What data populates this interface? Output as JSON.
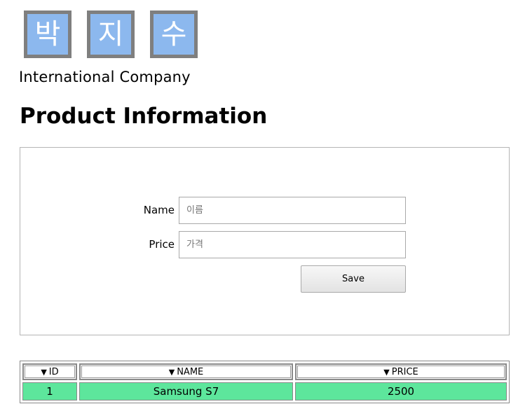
{
  "logo": {
    "chars": [
      "박",
      "지",
      "수"
    ]
  },
  "company": "International Company",
  "page_title": "Product Information",
  "form": {
    "name_label": "Name",
    "name_placeholder": "이름",
    "name_value": "",
    "price_label": "Price",
    "price_placeholder": "가격",
    "price_value": "",
    "save_label": "Save"
  },
  "table": {
    "sort_icon": "▼",
    "columns": [
      "ID",
      "NAME",
      "PRICE"
    ],
    "rows": [
      [
        "1",
        "Samsung S7",
        "2500"
      ]
    ]
  },
  "colors": {
    "logo_tile": "#8cb8ee",
    "logo_border": "#7f7f7f",
    "row_highlight": "#5de69c"
  }
}
